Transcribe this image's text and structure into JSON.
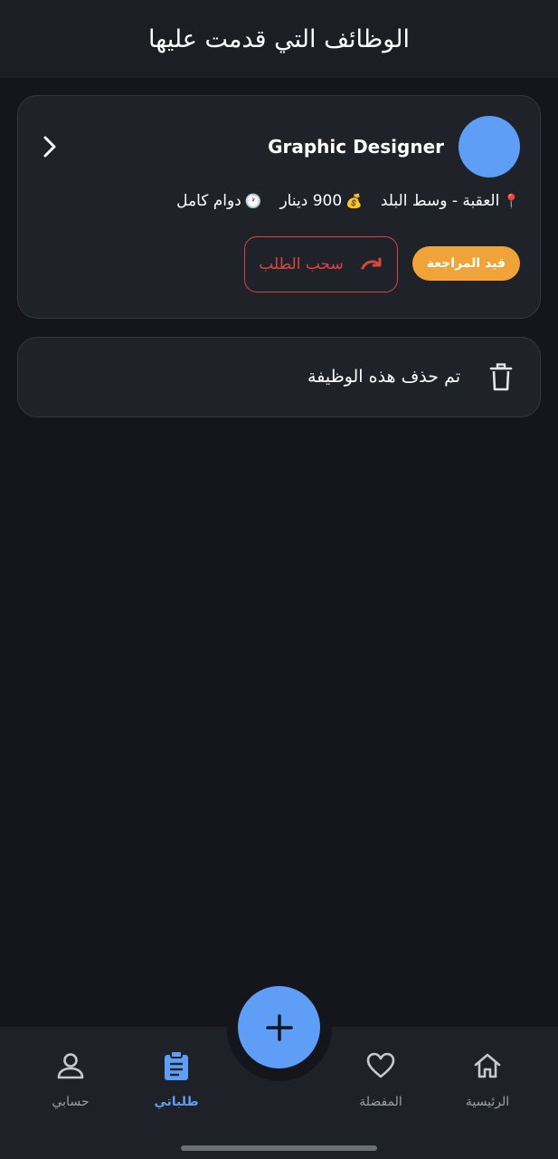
{
  "header": {
    "title": "الوظائف التي قدمت عليها"
  },
  "job_card": {
    "title": "Graphic Designer",
    "avatar_color": "#5e9ef6",
    "chevron_icon": "chevron-right-icon",
    "location": {
      "icon": "📍",
      "text": "العقبة - وسط البلد"
    },
    "salary": {
      "icon": "💰",
      "text": "900 دينار"
    },
    "job_type": {
      "icon": "🕐",
      "text": "دوام كامل"
    },
    "status": {
      "label": "قيد المراجعة",
      "color": "#f0a338"
    },
    "withdraw": {
      "label": "سحب الطلب",
      "color": "#d9453f",
      "icon": "redo-icon"
    }
  },
  "deleted_card": {
    "text": "تم حذف هذه الوظيفة",
    "icon": "trash-icon"
  },
  "bottom_nav": {
    "items": [
      {
        "label": "الرئيسية",
        "icon": "home-icon",
        "active": false
      },
      {
        "label": "المفضلة",
        "icon": "heart-icon",
        "active": false
      },
      {
        "label": "طلباتي",
        "icon": "clipboard-icon",
        "active": true
      },
      {
        "label": "حسابي",
        "icon": "user-icon",
        "active": false
      }
    ],
    "fab": {
      "icon": "plus-icon",
      "color": "#5e9ef6"
    }
  },
  "colors": {
    "background": "#14161b",
    "card": "#1f2229",
    "accent": "#5e9ef6",
    "inactive": "#9aa0aa"
  }
}
